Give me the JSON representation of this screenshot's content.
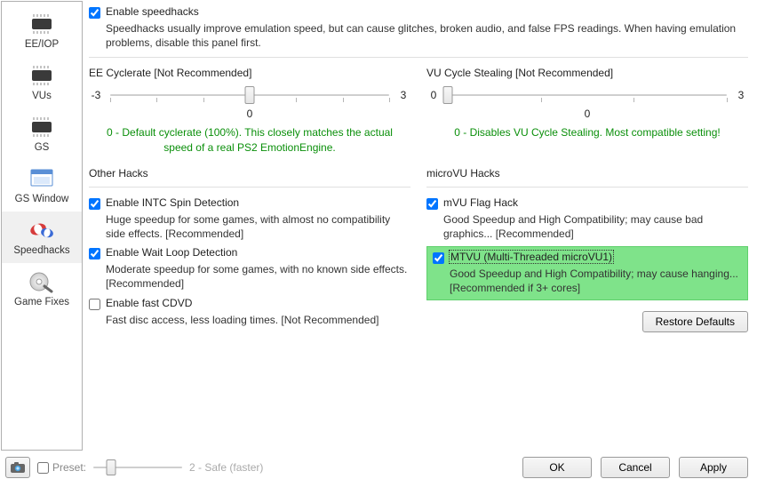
{
  "sidebar": {
    "items": [
      {
        "label": "EE/IOP"
      },
      {
        "label": "VUs"
      },
      {
        "label": "GS"
      },
      {
        "label": "GS Window"
      },
      {
        "label": "Speedhacks"
      },
      {
        "label": "Game Fixes"
      }
    ]
  },
  "enable": {
    "label": "Enable speedhacks",
    "desc": "Speedhacks usually improve emulation speed, but can cause glitches, broken audio, and false FPS readings.  When having emulation problems, disable this panel first."
  },
  "ee": {
    "title": "EE Cyclerate [Not Recommended]",
    "min": "-3",
    "max": "3",
    "value": "0",
    "hint": "0 - Default cyclerate (100%). This closely matches the actual speed of a real PS2 EmotionEngine."
  },
  "vu": {
    "title": "VU Cycle Stealing [Not Recommended]",
    "min": "0",
    "max": "3",
    "value": "0",
    "hint": "0 - Disables VU Cycle Stealing.  Most compatible setting!"
  },
  "other": {
    "title": "Other Hacks",
    "intc": {
      "label": "Enable INTC Spin Detection",
      "desc": "Huge speedup for some games, with almost no compatibility side effects. [Recommended]"
    },
    "wait": {
      "label": "Enable Wait Loop Detection",
      "desc": "Moderate speedup for some games, with no known side effects. [Recommended]"
    },
    "cdvd": {
      "label": "Enable fast CDVD",
      "desc": "Fast disc access, less loading times. [Not Recommended]"
    }
  },
  "mvu": {
    "title": "microVU Hacks",
    "flag": {
      "label": "mVU Flag Hack",
      "desc": "Good Speedup and High Compatibility; may cause bad graphics... [Recommended]"
    },
    "mtvu": {
      "label": "MTVU (Multi-Threaded microVU1)",
      "desc": "Good Speedup and High Compatibility; may cause hanging... [Recommended if 3+ cores]"
    }
  },
  "buttons": {
    "restore": "Restore Defaults",
    "ok": "OK",
    "cancel": "Cancel",
    "apply": "Apply"
  },
  "preset": {
    "label": "Preset:",
    "value": "2 - Safe (faster)"
  }
}
